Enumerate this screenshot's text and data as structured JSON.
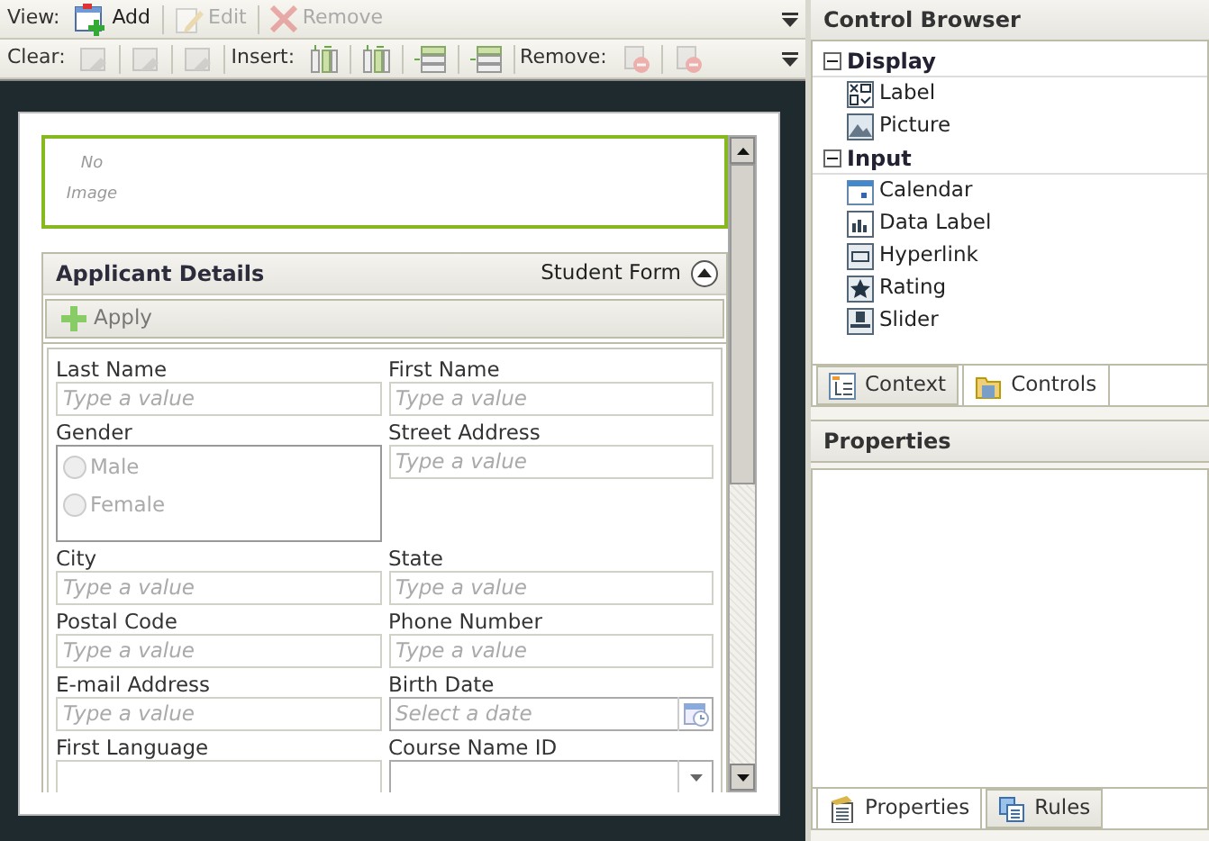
{
  "toolbar": {
    "view_row": {
      "label": "View:",
      "buttons": [
        {
          "label": "Add",
          "kind": "add",
          "disabled": false
        },
        {
          "label": "Edit",
          "kind": "edit",
          "disabled": true
        },
        {
          "label": "Remove",
          "kind": "remove",
          "disabled": true
        }
      ]
    },
    "tools_row": [
      {
        "label": "Clear:",
        "buttons": [
          {
            "kind": "clear",
            "disabled": true
          },
          {
            "kind": "clear",
            "disabled": true
          },
          {
            "kind": "clear",
            "disabled": true
          }
        ]
      },
      {
        "label": "Insert:",
        "buttons": [
          {
            "kind": "column",
            "disabled": false
          },
          {
            "kind": "column",
            "disabled": false
          },
          {
            "kind": "row",
            "disabled": false
          },
          {
            "kind": "row",
            "disabled": false
          }
        ]
      },
      {
        "label": "Remove:",
        "buttons": [
          {
            "kind": "delete",
            "disabled": true
          },
          {
            "kind": "delete",
            "disabled": true
          }
        ]
      }
    ]
  },
  "form": {
    "picture": {
      "placeholder": "No Image",
      "selected": true
    },
    "section": {
      "title": "Applicant Details",
      "subtitle": "Student Form",
      "expanded": true,
      "action": "Apply",
      "fields": [
        {
          "label": "Last Name",
          "kind": "text",
          "placeholder": "Type a value"
        },
        {
          "label": "First Name",
          "kind": "text",
          "placeholder": "Type a value"
        },
        {
          "label": "Gender",
          "kind": "radio",
          "options": [
            {
              "label": "Male",
              "checked": false
            },
            {
              "label": "Female",
              "checked": false
            }
          ]
        },
        {
          "label": "Street Address",
          "kind": "text",
          "placeholder": "Type a value"
        },
        {
          "label": "City",
          "kind": "text",
          "placeholder": "Type a value"
        },
        {
          "label": "State",
          "kind": "text",
          "placeholder": "Type a value"
        },
        {
          "label": "Postal Code",
          "kind": "text",
          "placeholder": "Type a value"
        },
        {
          "label": "Phone Number",
          "kind": "text",
          "placeholder": "Type a value"
        },
        {
          "label": "E-mail Address",
          "kind": "text",
          "placeholder": "Type a value"
        },
        {
          "label": "Birth Date",
          "kind": "date",
          "placeholder": "Select a date"
        },
        {
          "label": "First Language",
          "kind": "text"
        },
        {
          "label": "Course Name ID",
          "kind": "dropdown"
        }
      ]
    }
  },
  "control_browser": {
    "title": "Control Browser",
    "groups": [
      {
        "label": "Display",
        "expanded": true,
        "children": [
          {
            "label": "Label",
            "kind": "label"
          },
          {
            "label": "Picture",
            "kind": "picture"
          }
        ]
      },
      {
        "label": "Input",
        "expanded": true,
        "children": [
          {
            "label": "Calendar",
            "kind": "calendar"
          },
          {
            "label": "Data Label",
            "kind": "datalabel"
          },
          {
            "label": "Hyperlink",
            "kind": "hyperlink"
          },
          {
            "label": "Rating",
            "kind": "rating"
          },
          {
            "label": "Slider",
            "kind": "slider"
          }
        ]
      }
    ],
    "tabs": [
      {
        "label": "Context",
        "kind": "context",
        "selected": false
      },
      {
        "label": "Controls",
        "kind": "controls",
        "selected": true
      }
    ]
  },
  "properties": {
    "title": "Properties",
    "tabs": [
      {
        "label": "Properties",
        "kind": "properties",
        "selected": true
      },
      {
        "label": "Rules",
        "kind": "rules",
        "selected": false
      }
    ]
  }
}
